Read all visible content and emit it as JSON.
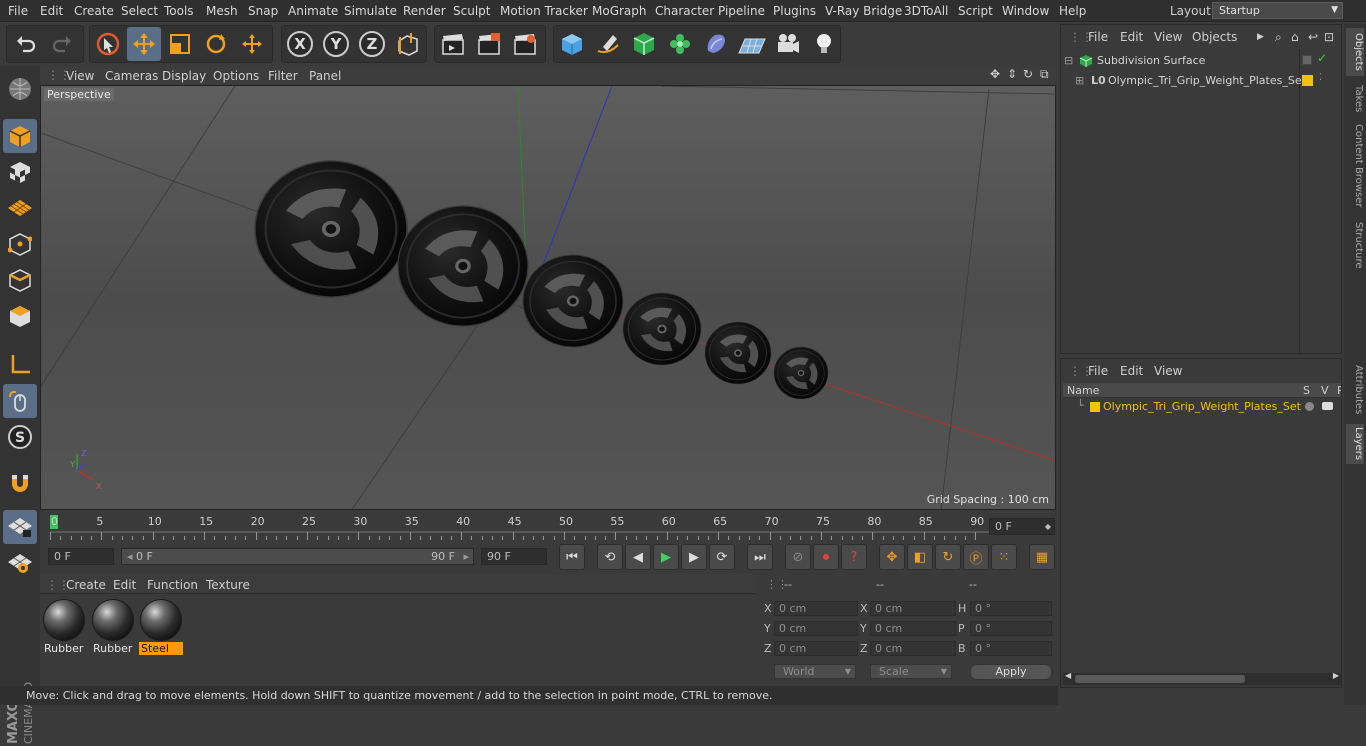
{
  "menubar": {
    "items": [
      "File",
      "Edit",
      "Create",
      "Select",
      "Tools",
      "Mesh",
      "Snap",
      "Animate",
      "Simulate",
      "Render",
      "Sculpt",
      "Motion Tracker",
      "MoGraph",
      "Character",
      "Pipeline",
      "Plugins",
      "V-Ray Bridge",
      "3DToAll",
      "Script",
      "Window",
      "Help"
    ],
    "layout_label": "Layout:",
    "layout_value": "Startup"
  },
  "viewport": {
    "menu": [
      "View",
      "Cameras",
      "Display",
      "Options",
      "Filter",
      "Panel"
    ],
    "camera_label": "Perspective",
    "grid_spacing": "Grid Spacing : 100 cm"
  },
  "timeline": {
    "ticks": [
      "0",
      "5",
      "10",
      "15",
      "20",
      "25",
      "30",
      "35",
      "40",
      "45",
      "50",
      "55",
      "60",
      "65",
      "70",
      "75",
      "80",
      "85",
      "90"
    ],
    "current_frame": "0 F",
    "start_frame": "0 F",
    "range_start": "0 F",
    "range_end": "90 F",
    "end_frame": "90 F"
  },
  "materials": {
    "menu": [
      "Create",
      "Edit",
      "Function",
      "Texture"
    ],
    "items": [
      {
        "label": "Rubber",
        "selected": false
      },
      {
        "label": "Rubber",
        "selected": false
      },
      {
        "label": "Steel",
        "selected": true
      }
    ]
  },
  "coords": {
    "headers": [
      "--",
      "--",
      "--"
    ],
    "rows": [
      {
        "a": "X",
        "av": "0 cm",
        "b": "X",
        "bv": "0 cm",
        "c": "H",
        "cv": "0 °"
      },
      {
        "a": "Y",
        "av": "0 cm",
        "b": "Y",
        "bv": "0 cm",
        "c": "P",
        "cv": "0 °"
      },
      {
        "a": "Z",
        "av": "0 cm",
        "b": "Z",
        "bv": "0 cm",
        "c": "B",
        "cv": "0 °"
      }
    ],
    "space": "World",
    "mode": "Scale",
    "apply_label": "Apply"
  },
  "status": "Move: Click and drag to move elements. Hold down SHIFT to quantize movement / add to the selection in point mode, CTRL to remove.",
  "objects_panel": {
    "menu": [
      "File",
      "Edit",
      "View",
      "Objects"
    ],
    "tree": [
      {
        "label": "Subdivision Surface",
        "color": "#d4d4d4"
      },
      {
        "label": "Olympic_Tri_Grip_Weight_Plates_Set",
        "color": "#d4d4d4"
      }
    ]
  },
  "layers_panel": {
    "menu": [
      "File",
      "Edit",
      "View"
    ],
    "columns": {
      "name": "Name",
      "s": "S",
      "v": "V",
      "r": "R"
    },
    "rows": [
      {
        "label": "Olympic_Tri_Grip_Weight_Plates_Set",
        "color": "#f2c400"
      }
    ]
  },
  "right_tabs": [
    "Objects",
    "Takes",
    "Content Browser",
    "Structure",
    "Attributes",
    "Layers"
  ],
  "colors": {
    "accent_orange": "#ff9b00",
    "layer_yellow": "#f2c400",
    "highlight_blue": "#5a6f87"
  }
}
